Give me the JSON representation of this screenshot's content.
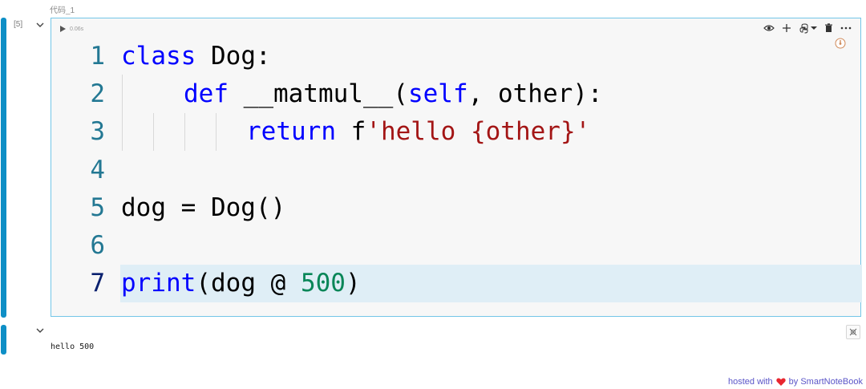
{
  "cell": {
    "title": "代码_1",
    "execution_count": "[5]",
    "run_duration": "0.06s",
    "toolbar": {
      "icons": [
        "eye-icon",
        "plus-icon",
        "python-kernel-icon",
        "dropdown-icon",
        "trash-icon",
        "more-icon"
      ]
    },
    "code": {
      "line_numbers": [
        "1",
        "2",
        "3",
        "4",
        "5",
        "6",
        "7"
      ],
      "line1": {
        "kw": "class",
        "rest": " Dog:"
      },
      "line2": {
        "kw": "def",
        "name": " __matmul__(",
        "self": "self",
        "rest": ", other):"
      },
      "line3": {
        "kw": "return",
        "plain": " f",
        "str": "'hello {other}'"
      },
      "line5": {
        "text": "dog = Dog()"
      },
      "line7": {
        "fn": "print",
        "mid": "(dog @ ",
        "num": "500",
        "end": ")"
      }
    }
  },
  "output": {
    "text": "hello 500"
  },
  "footer": {
    "prefix": "hosted with",
    "suffix": "by SmartNoteBook"
  },
  "colors": {
    "accent_bar": "#0e8fc6",
    "keyword": "#0000ff",
    "string": "#a31515",
    "number": "#098658",
    "line_number": "#237893"
  }
}
